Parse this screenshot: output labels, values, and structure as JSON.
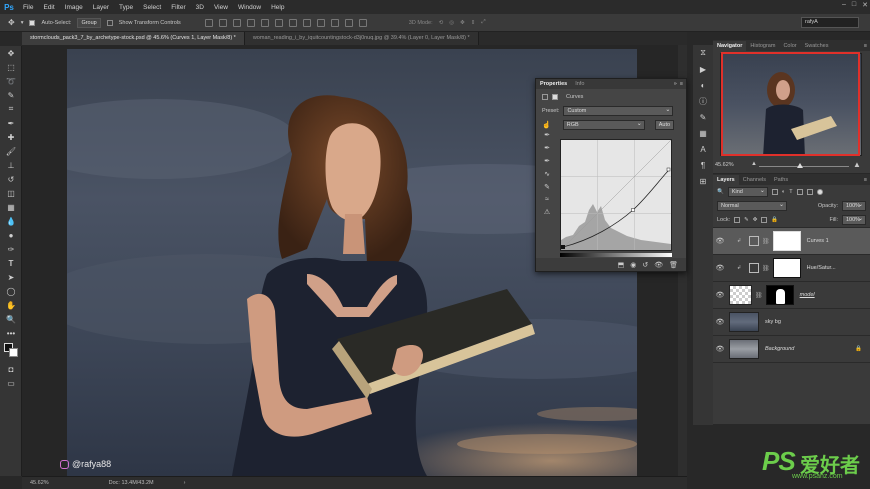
{
  "app": {
    "logo": "Ps"
  },
  "menu": [
    "File",
    "Edit",
    "Image",
    "Layer",
    "Type",
    "Select",
    "Filter",
    "3D",
    "View",
    "Window",
    "Help"
  ],
  "options_bar": {
    "auto_select_label": "Auto-Select:",
    "auto_select_value": "Group",
    "transform_label": "Show Transform Controls",
    "mode_3d_label": "3D Mode:",
    "search_value": "rafyA"
  },
  "tabs": [
    {
      "label": "stormclouds_pack3_7_by_archetype-stock.psd @ 45.6% (Curves 1, Layer Mask/8) *",
      "active": true
    },
    {
      "label": "woman_reading_i_by_iquitcountingstock-d3j0nuq.jpg @ 39.4% (Layer 0, Layer Mask/8) *",
      "active": false
    }
  ],
  "status": {
    "zoom": "45.62%",
    "doc_info": "Doc: 13.4M/43.2M"
  },
  "watermark": {
    "handle": "@rafya88"
  },
  "properties": {
    "tab_active": "Properties",
    "tab_other": "Info",
    "layer_type": "Curves",
    "preset_label": "Preset:",
    "preset_value": "Custom",
    "channel_value": "RGB",
    "auto_label": "Auto"
  },
  "navigator": {
    "tabs": [
      "Navigator",
      "Histogram",
      "Color",
      "Swatches"
    ],
    "zoom": "45.62%",
    "zoom_level": 0.46
  },
  "layers": {
    "tabs": [
      "Layers",
      "Channels",
      "Paths"
    ],
    "filter_label": "Kind",
    "blend_mode": "Normal",
    "opacity_label": "Opacity:",
    "opacity_value": "100%",
    "lock_label": "Lock:",
    "fill_label": "Fill:",
    "fill_value": "100%",
    "items": [
      {
        "name": "Curves 1"
      },
      {
        "name": "Hue/Satur..."
      },
      {
        "name": "model"
      },
      {
        "name": "sky bg"
      },
      {
        "name": "Background"
      }
    ]
  },
  "brand": {
    "logo": "PS",
    "chinese": "爱好者",
    "url": "www.psahz.com"
  },
  "colors": {
    "accent": "#31a8ff",
    "highlight": "#e0302a",
    "brand": "#6ccd4b"
  }
}
